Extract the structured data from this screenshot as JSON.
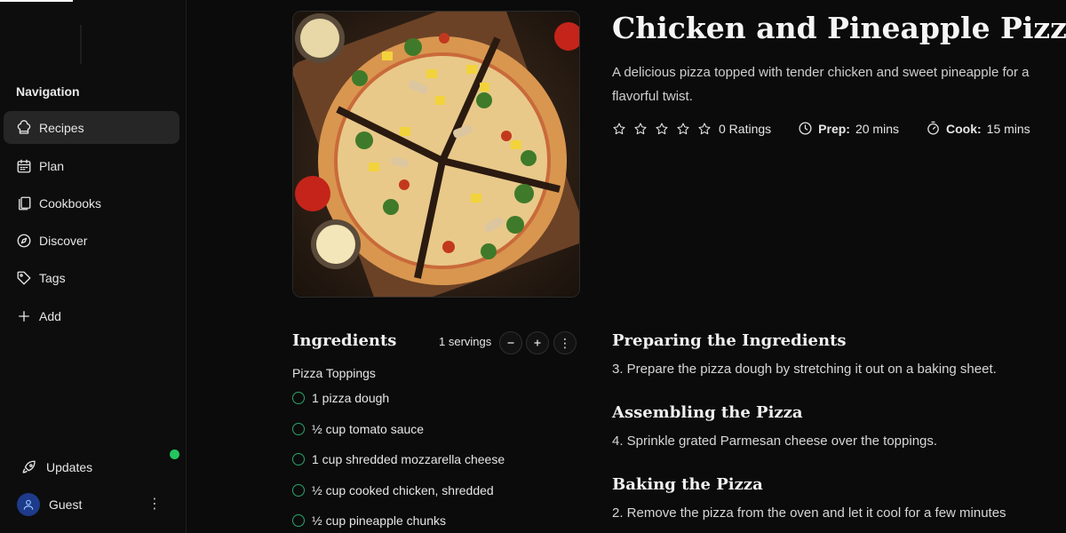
{
  "sidebar": {
    "section_title": "Navigation",
    "items": [
      {
        "label": "Recipes",
        "icon": "chef-hat-icon",
        "active": true
      },
      {
        "label": "Plan",
        "icon": "calendar-icon",
        "active": false
      },
      {
        "label": "Cookbooks",
        "icon": "cookbooks-icon",
        "active": false
      },
      {
        "label": "Discover",
        "icon": "compass-icon",
        "active": false
      },
      {
        "label": "Tags",
        "icon": "tag-icon",
        "active": false
      },
      {
        "label": "Add",
        "icon": "plus-icon",
        "active": false
      }
    ],
    "updates_label": "Updates",
    "updates_dot_color": "#22c55e",
    "user_label": "Guest"
  },
  "recipe": {
    "title": "Chicken and Pineapple Pizza",
    "description": "A delicious pizza topped with tender chicken and sweet pineapple for a flavorful twist.",
    "rating_count": "0 Ratings",
    "prep_label": "Prep:",
    "prep_value": "20 mins",
    "cook_label": "Cook:",
    "cook_value": "15 mins",
    "stars_filled": 0
  },
  "ingredients": {
    "heading": "Ingredients",
    "servings": "1 servings",
    "group_title": "Pizza Toppings",
    "items": [
      "1 pizza dough",
      "½ cup tomato sauce",
      "1 cup shredded mozzarella cheese",
      "½ cup cooked chicken, shredded",
      "½ cup pineapple chunks"
    ]
  },
  "instructions": [
    {
      "heading": "Preparing the Ingredients",
      "text": "3. Prepare the pizza dough by stretching it out on a baking sheet."
    },
    {
      "heading": "Assembling the Pizza",
      "text": "4. Sprinkle grated Parmesan cheese over the toppings."
    },
    {
      "heading": "Baking the Pizza",
      "text": "2. Remove the pizza from the oven and let it cool for a few minutes"
    }
  ],
  "colors": {
    "accent_green": "#2aa56b",
    "background": "#0b0b0b"
  }
}
